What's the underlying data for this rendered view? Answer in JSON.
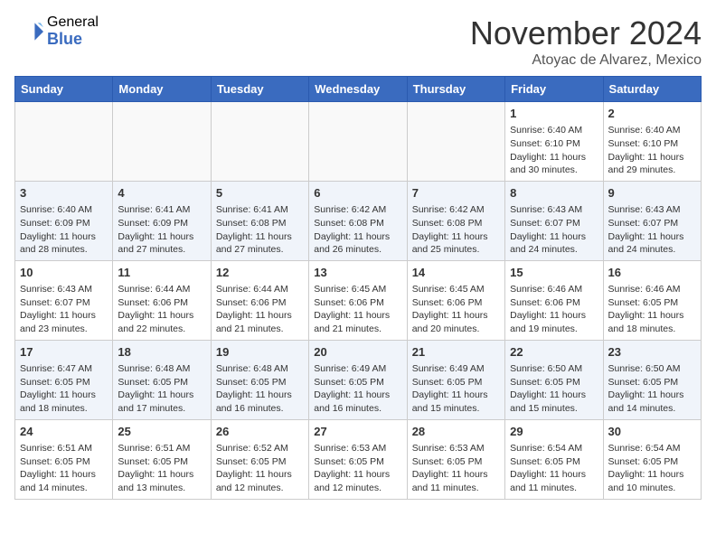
{
  "header": {
    "logo_general": "General",
    "logo_blue": "Blue",
    "month": "November 2024",
    "location": "Atoyac de Alvarez, Mexico"
  },
  "weekdays": [
    "Sunday",
    "Monday",
    "Tuesday",
    "Wednesday",
    "Thursday",
    "Friday",
    "Saturday"
  ],
  "weeks": [
    [
      {
        "day": "",
        "info": ""
      },
      {
        "day": "",
        "info": ""
      },
      {
        "day": "",
        "info": ""
      },
      {
        "day": "",
        "info": ""
      },
      {
        "day": "",
        "info": ""
      },
      {
        "day": "1",
        "info": "Sunrise: 6:40 AM\nSunset: 6:10 PM\nDaylight: 11 hours and 30 minutes."
      },
      {
        "day": "2",
        "info": "Sunrise: 6:40 AM\nSunset: 6:10 PM\nDaylight: 11 hours and 29 minutes."
      }
    ],
    [
      {
        "day": "3",
        "info": "Sunrise: 6:40 AM\nSunset: 6:09 PM\nDaylight: 11 hours and 28 minutes."
      },
      {
        "day": "4",
        "info": "Sunrise: 6:41 AM\nSunset: 6:09 PM\nDaylight: 11 hours and 27 minutes."
      },
      {
        "day": "5",
        "info": "Sunrise: 6:41 AM\nSunset: 6:08 PM\nDaylight: 11 hours and 27 minutes."
      },
      {
        "day": "6",
        "info": "Sunrise: 6:42 AM\nSunset: 6:08 PM\nDaylight: 11 hours and 26 minutes."
      },
      {
        "day": "7",
        "info": "Sunrise: 6:42 AM\nSunset: 6:08 PM\nDaylight: 11 hours and 25 minutes."
      },
      {
        "day": "8",
        "info": "Sunrise: 6:43 AM\nSunset: 6:07 PM\nDaylight: 11 hours and 24 minutes."
      },
      {
        "day": "9",
        "info": "Sunrise: 6:43 AM\nSunset: 6:07 PM\nDaylight: 11 hours and 24 minutes."
      }
    ],
    [
      {
        "day": "10",
        "info": "Sunrise: 6:43 AM\nSunset: 6:07 PM\nDaylight: 11 hours and 23 minutes."
      },
      {
        "day": "11",
        "info": "Sunrise: 6:44 AM\nSunset: 6:06 PM\nDaylight: 11 hours and 22 minutes."
      },
      {
        "day": "12",
        "info": "Sunrise: 6:44 AM\nSunset: 6:06 PM\nDaylight: 11 hours and 21 minutes."
      },
      {
        "day": "13",
        "info": "Sunrise: 6:45 AM\nSunset: 6:06 PM\nDaylight: 11 hours and 21 minutes."
      },
      {
        "day": "14",
        "info": "Sunrise: 6:45 AM\nSunset: 6:06 PM\nDaylight: 11 hours and 20 minutes."
      },
      {
        "day": "15",
        "info": "Sunrise: 6:46 AM\nSunset: 6:06 PM\nDaylight: 11 hours and 19 minutes."
      },
      {
        "day": "16",
        "info": "Sunrise: 6:46 AM\nSunset: 6:05 PM\nDaylight: 11 hours and 18 minutes."
      }
    ],
    [
      {
        "day": "17",
        "info": "Sunrise: 6:47 AM\nSunset: 6:05 PM\nDaylight: 11 hours and 18 minutes."
      },
      {
        "day": "18",
        "info": "Sunrise: 6:48 AM\nSunset: 6:05 PM\nDaylight: 11 hours and 17 minutes."
      },
      {
        "day": "19",
        "info": "Sunrise: 6:48 AM\nSunset: 6:05 PM\nDaylight: 11 hours and 16 minutes."
      },
      {
        "day": "20",
        "info": "Sunrise: 6:49 AM\nSunset: 6:05 PM\nDaylight: 11 hours and 16 minutes."
      },
      {
        "day": "21",
        "info": "Sunrise: 6:49 AM\nSunset: 6:05 PM\nDaylight: 11 hours and 15 minutes."
      },
      {
        "day": "22",
        "info": "Sunrise: 6:50 AM\nSunset: 6:05 PM\nDaylight: 11 hours and 15 minutes."
      },
      {
        "day": "23",
        "info": "Sunrise: 6:50 AM\nSunset: 6:05 PM\nDaylight: 11 hours and 14 minutes."
      }
    ],
    [
      {
        "day": "24",
        "info": "Sunrise: 6:51 AM\nSunset: 6:05 PM\nDaylight: 11 hours and 14 minutes."
      },
      {
        "day": "25",
        "info": "Sunrise: 6:51 AM\nSunset: 6:05 PM\nDaylight: 11 hours and 13 minutes."
      },
      {
        "day": "26",
        "info": "Sunrise: 6:52 AM\nSunset: 6:05 PM\nDaylight: 11 hours and 12 minutes."
      },
      {
        "day": "27",
        "info": "Sunrise: 6:53 AM\nSunset: 6:05 PM\nDaylight: 11 hours and 12 minutes."
      },
      {
        "day": "28",
        "info": "Sunrise: 6:53 AM\nSunset: 6:05 PM\nDaylight: 11 hours and 11 minutes."
      },
      {
        "day": "29",
        "info": "Sunrise: 6:54 AM\nSunset: 6:05 PM\nDaylight: 11 hours and 11 minutes."
      },
      {
        "day": "30",
        "info": "Sunrise: 6:54 AM\nSunset: 6:05 PM\nDaylight: 11 hours and 10 minutes."
      }
    ]
  ]
}
